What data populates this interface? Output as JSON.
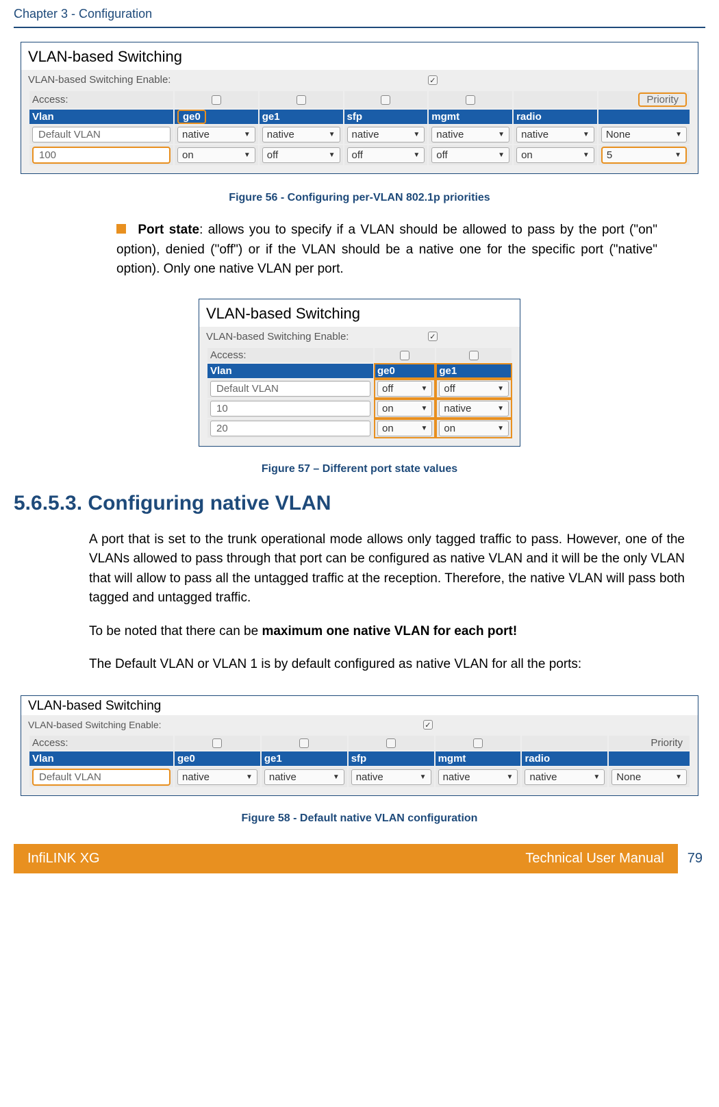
{
  "header": {
    "chapter": "Chapter 3 - Configuration"
  },
  "figure56": {
    "title": "VLAN-based Switching",
    "enable_label": "VLAN-based Switching Enable:",
    "access_label": "Access:",
    "priority_label": "Priority",
    "cols": {
      "vlan": "Vlan",
      "ge0": "ge0",
      "ge1": "ge1",
      "sfp": "sfp",
      "mgmt": "mgmt",
      "radio": "radio"
    },
    "row1": {
      "vlan": "Default VLAN",
      "ge0": "native",
      "ge1": "native",
      "sfp": "native",
      "mgmt": "native",
      "radio": "native",
      "priority": "None"
    },
    "row2": {
      "vlan": "100",
      "ge0": "on",
      "ge1": "off",
      "sfp": "off",
      "mgmt": "off",
      "radio": "on",
      "priority": "5"
    },
    "caption": "Figure 56 - Configuring per-VLAN 802.1p priorities"
  },
  "bullet": {
    "label": "Port state",
    "text": ": allows you to specify if a VLAN should be allowed to pass by the port (\"on\" option), denied (\"off\") or if the VLAN should be a native one for the specific port (\"native\" option). Only one native VLAN per port."
  },
  "figure57": {
    "title": "VLAN-based Switching",
    "enable_label": "VLAN-based Switching Enable:",
    "access_label": "Access:",
    "cols": {
      "vlan": "Vlan",
      "ge0": "ge0",
      "ge1": "ge1"
    },
    "row1": {
      "vlan": "Default VLAN",
      "ge0": "off",
      "ge1": "off"
    },
    "row2": {
      "vlan": "10",
      "ge0": "on",
      "ge1": "native"
    },
    "row3": {
      "vlan": "20",
      "ge0": "on",
      "ge1": "on"
    },
    "caption": "Figure 57 – Different port state values"
  },
  "section": {
    "heading": "5.6.5.3. Configuring native VLAN",
    "p1": "A port that is set to the trunk operational mode allows only tagged traffic to pass. However, one of the VLANs allowed to pass through that port can be configured as native VLAN and it will be the only VLAN that will allow to pass all the untagged traffic at the reception. Therefore, the native VLAN will pass both tagged and untagged traffic.",
    "p2a": "To be noted that there can be ",
    "p2b": "maximum one native VLAN for each port!",
    "p3": "The Default VLAN or VLAN 1 is by default configured as native VLAN for all the ports:"
  },
  "figure58": {
    "title": "VLAN-based Switching",
    "enable_label": "VLAN-based Switching Enable:",
    "access_label": "Access:",
    "priority_label": "Priority",
    "cols": {
      "vlan": "Vlan",
      "ge0": "ge0",
      "ge1": "ge1",
      "sfp": "sfp",
      "mgmt": "mgmt",
      "radio": "radio"
    },
    "row1": {
      "vlan": "Default VLAN",
      "ge0": "native",
      "ge1": "native",
      "sfp": "native",
      "mgmt": "native",
      "radio": "native",
      "priority": "None"
    },
    "caption": "Figure 58 - Default native VLAN configuration"
  },
  "footer": {
    "left": "InfiLINK XG",
    "right": "Technical User Manual",
    "page": "79"
  }
}
